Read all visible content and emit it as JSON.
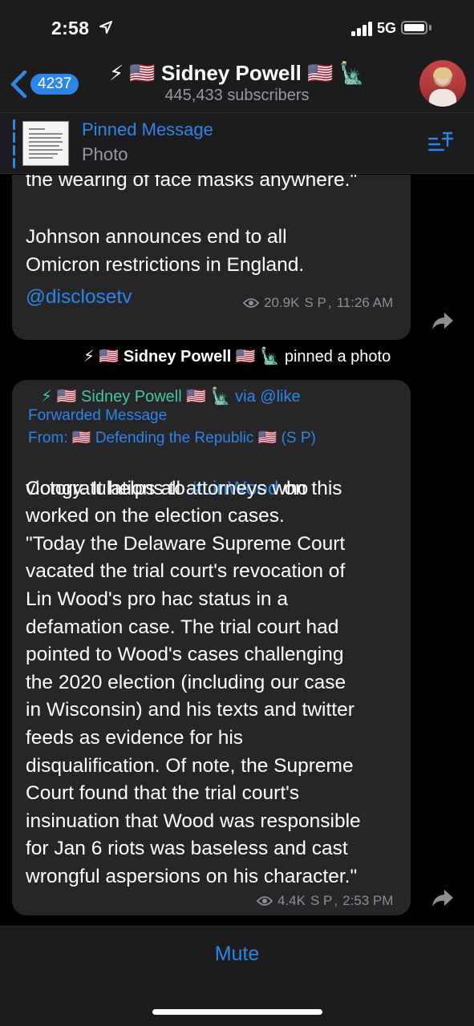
{
  "status_bar": {
    "time": "2:58",
    "network": "5G"
  },
  "header": {
    "back_count": "4237",
    "title": "⚡ 🇺🇸 Sidney Powell 🇺🇸 🗽",
    "subtitle": "445,433 subscribers"
  },
  "pinned": {
    "title": "Pinned Message",
    "subtitle": "Photo"
  },
  "messages": [
    {
      "text_partial": "the wearing of face masks anywhere.\"",
      "text": "Johnson announces end to all\nOmicron restrictions in England.",
      "link": "@disclosetv",
      "views": "20.9K",
      "author": "S P",
      "time": "11:26 AM"
    },
    {
      "service": {
        "name": "⚡ 🇺🇸 Sidney Powell 🇺🇸 🗽",
        "action": "pinned a photo"
      }
    },
    {
      "sender": "⚡ 🇺🇸 Sidney Powell 🇺🇸 🗽",
      "via": "via @like",
      "forward_label": "Forwarded Message",
      "from_label": "From:",
      "from_channel": "🇺🇸 Defending the Republic 🇺🇸",
      "from_author": "(S P)",
      "text_pre": "Congratulations to ",
      "hashtag": "#LinWood",
      "text_post": " on this",
      "text": "victory.  It helps all attorneys who\nworked on the election cases.\n\"Today the Delaware Supreme Court\nvacated the trial court's revocation of\nLin Wood's pro hac status in a\ndefamation case. The trial court had\npointed to Wood's cases challenging\nthe 2020 election (including our case\nin Wisconsin) and his texts and twitter\nfeeds as evidence for his\ndisqualification. Of note, the Supreme\nCourt found that the trial court's\ninsinuation that Wood was responsible\nfor Jan 6 riots was baseless and cast\nwrongful aspersions on his character.\"",
      "views": "4.4K",
      "author": "S P",
      "time": "2:53 PM"
    }
  ],
  "bottom": {
    "mute_label": "Mute"
  },
  "colors": {
    "accent": "#2d85e6",
    "sender_green": "#41c8a0",
    "bubble": "#262628",
    "bar": "#1c1c1e"
  }
}
